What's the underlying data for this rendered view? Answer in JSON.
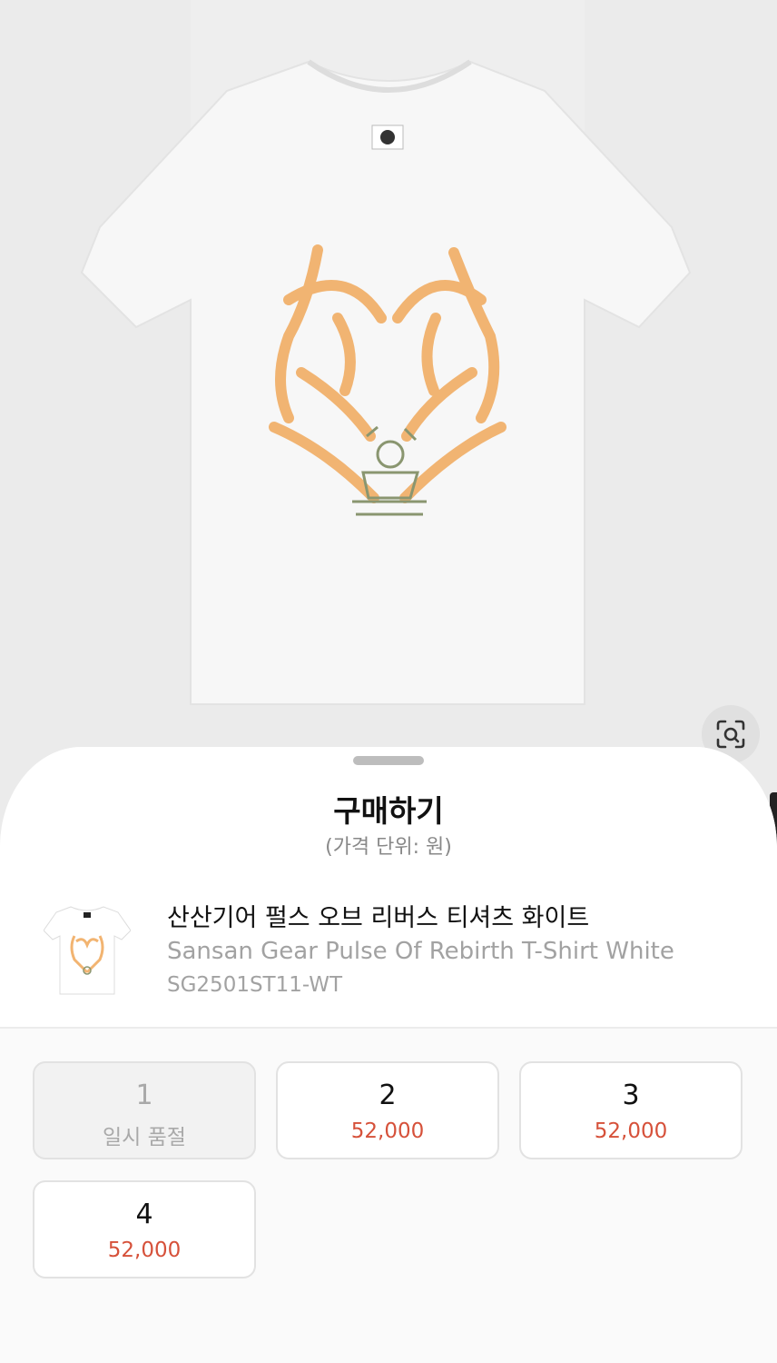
{
  "hero": {
    "image": "white-t-shirt-orange-heart-print",
    "lens_icon": "visual-search-icon"
  },
  "sheet": {
    "title": "구매하기",
    "subtitle": "(가격 단위: 원)"
  },
  "product": {
    "name_ko": "산산기어 펄스 오브 리버스 티셔츠 화이트",
    "name_en": "Sansan Gear Pulse Of Rebirth T-Shirt White",
    "sku": "SG2501ST11-WT"
  },
  "sizes": [
    {
      "label": "1",
      "price": "일시 품절",
      "available": false
    },
    {
      "label": "2",
      "price": "52,000",
      "available": true
    },
    {
      "label": "3",
      "price": "52,000",
      "available": true
    },
    {
      "label": "4",
      "price": "52,000",
      "available": true
    }
  ],
  "colors": {
    "price": "#d6513a",
    "muted": "#a2a2a2",
    "print": "#f0a24e"
  }
}
